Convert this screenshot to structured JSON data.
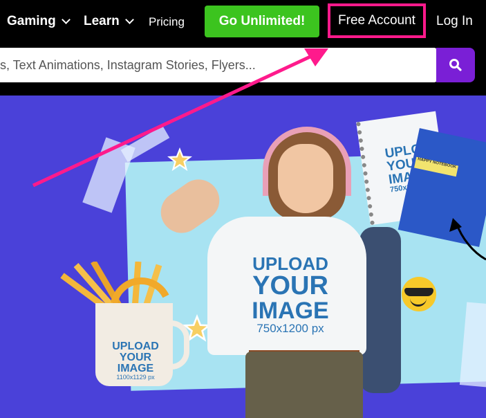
{
  "nav": {
    "gaming_label": "Gaming",
    "learn_label": "Learn",
    "pricing_label": "Pricing",
    "go_unlimited_label": "Go Unlimited!",
    "free_account_label": "Free Account",
    "login_label": "Log In"
  },
  "search": {
    "placeholder": "s, Text Animations, Instagram Stories, Flyers...",
    "icon": "search-icon"
  },
  "hero": {
    "shirt_text_line1": "UPLOAD",
    "shirt_text_line2": "YOUR",
    "shirt_text_line3": "IMAGE",
    "shirt_text_size": "750x1200 px",
    "mug_text_line1": "UPLOAD",
    "mug_text_line2": "YOUR",
    "mug_text_line3": "IMAGE",
    "mug_text_size": "1100x1129 px",
    "notebook_text_line1": "UPLOAD",
    "notebook_text_line2": "YOUR",
    "notebook_text_line3": "IMAGE",
    "notebook_text_size": "750x10",
    "notebook2_label": "HAPPY NOTEBOOK"
  },
  "colors": {
    "go_unlimited": "#3cc41f",
    "highlight_border": "#ff1a8c",
    "search_button": "#7a1fd6",
    "hero_bg": "#4a41d9"
  }
}
